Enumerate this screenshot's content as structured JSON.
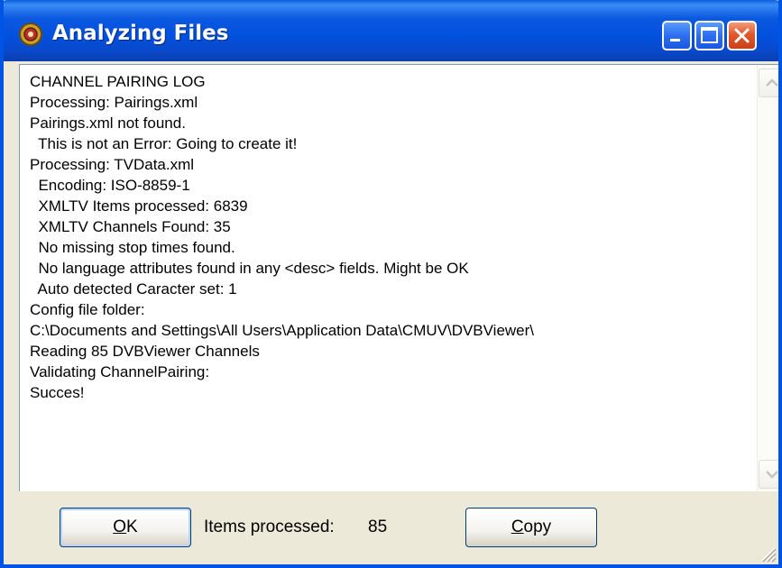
{
  "window": {
    "title": "Analyzing Files",
    "controls": {
      "minimize": "minimize-icon",
      "maximize": "maximize-icon",
      "close": "close-icon"
    }
  },
  "log": {
    "lines": [
      "CHANNEL PAIRING LOG",
      "Processing: Pairings.xml",
      "Pairings.xml not found.",
      "  This is not an Error: Going to create it!",
      "Processing: TVData.xml",
      "  Encoding: ISO-8859-1",
      "  XMLTV Items processed: 6839",
      "  XMLTV Channels Found: 35",
      "  No missing stop times found.",
      "  No language attributes found in any <desc> fields. Might be OK",
      "  Auto detected Caracter set: 1",
      "Config file folder:",
      "C:\\Documents and Settings\\All Users\\Application Data\\CMUV\\DVBViewer\\",
      "Reading 85 DVBViewer Channels",
      "Validating ChannelPairing:",
      "Succes!"
    ]
  },
  "footer": {
    "ok_accel": "O",
    "ok_rest": "K",
    "items_label": "Items processed:",
    "items_value": "85",
    "copy_accel": "C",
    "copy_rest": "opy"
  },
  "colors": {
    "title_bar": "#0054e3",
    "dialog_bg": "#ece9d8",
    "close_button": "#e2582e"
  }
}
